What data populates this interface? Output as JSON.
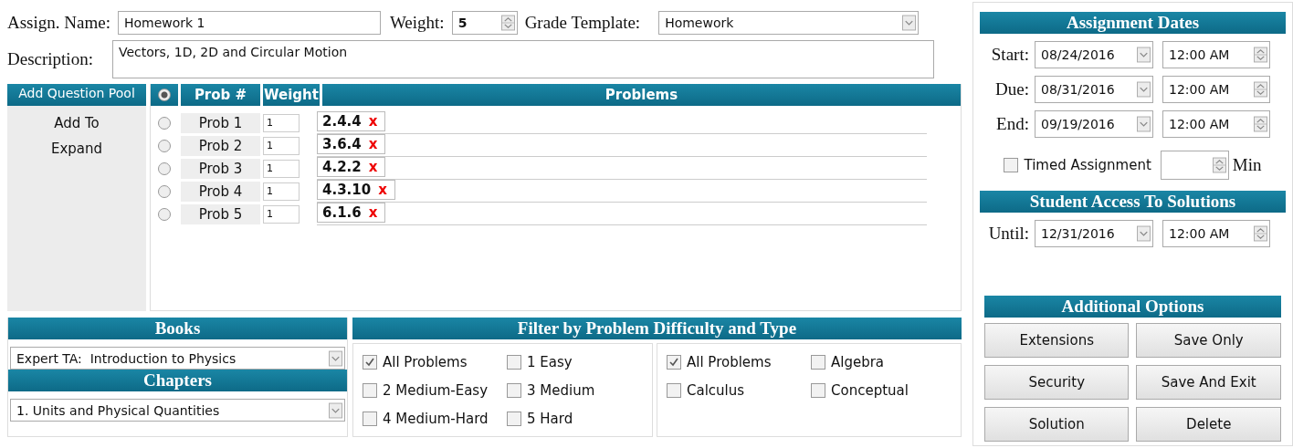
{
  "assignment": {
    "name_label": "Assign. Name:",
    "name": "Homework 1",
    "weight_label": "Weight:",
    "weight": "5",
    "template_label": "Grade Template:",
    "template": "Homework",
    "description_label": "Description:",
    "description": "Vectors, 1D, 2D and Circular Motion"
  },
  "pool_menu": {
    "title": "Add Question Pool",
    "items": [
      "Add To",
      "Expand"
    ]
  },
  "problems_table": {
    "header_radio_selected": true,
    "columns": [
      "Prob #",
      "Weight",
      "Problems"
    ],
    "rows": [
      {
        "selected": false,
        "number": "Prob 1",
        "weight": "1",
        "problem": "2.4.4",
        "remove": "x"
      },
      {
        "selected": false,
        "number": "Prob 2",
        "weight": "1",
        "problem": "3.6.4",
        "remove": "x"
      },
      {
        "selected": false,
        "number": "Prob 3",
        "weight": "1",
        "problem": "4.2.2",
        "remove": "x"
      },
      {
        "selected": false,
        "number": "Prob 4",
        "weight": "1",
        "problem": "4.3.10",
        "remove": "x"
      },
      {
        "selected": false,
        "number": "Prob 5",
        "weight": "1",
        "problem": "6.1.6",
        "remove": "x"
      }
    ]
  },
  "books": {
    "title": "Books",
    "book": "Expert TA:  Introduction to Physics",
    "chapters_title": "Chapters",
    "chapter": "1. Units and Physical Quantities"
  },
  "filter": {
    "title": "Filter by Problem Difficulty and Type",
    "groups": [
      [
        {
          "label": "All Problems",
          "checked": true
        },
        {
          "label": "1 Easy",
          "checked": false
        },
        {
          "label": "2 Medium-Easy",
          "checked": false
        },
        {
          "label": "3 Medium",
          "checked": false
        },
        {
          "label": "4 Medium-Hard",
          "checked": false
        },
        {
          "label": "5 Hard",
          "checked": false
        }
      ],
      [
        {
          "label": "All Problems",
          "checked": true
        },
        {
          "label": "Algebra",
          "checked": false
        },
        {
          "label": "Calculus",
          "checked": false
        },
        {
          "label": "Conceptual",
          "checked": false
        }
      ]
    ]
  },
  "dates": {
    "title": "Assignment Dates",
    "rows": [
      {
        "label": "Start:",
        "date": "08/24/2016",
        "time": "12:00 AM"
      },
      {
        "label": "Due:",
        "date": "08/31/2016",
        "time": "12:00 AM"
      },
      {
        "label": "End:",
        "date": "09/19/2016",
        "time": "12:00 AM"
      }
    ],
    "timed": {
      "label": "Timed Assignment",
      "checked": false,
      "unit": "Min"
    }
  },
  "solutions": {
    "title": "Student Access To Solutions",
    "label": "Until:",
    "date": "12/31/2016",
    "time": "12:00 AM"
  },
  "options": {
    "title": "Additional Options",
    "buttons": [
      "Extensions",
      "Save Only",
      "Security",
      "Save And Exit",
      "Solution",
      "Delete"
    ]
  }
}
